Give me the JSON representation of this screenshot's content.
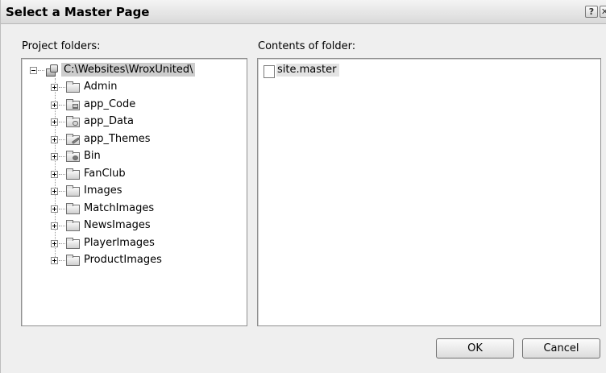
{
  "window": {
    "title": "Select a Master Page",
    "help_glyph": "?",
    "close_glyph": "✕"
  },
  "left": {
    "label": "Project folders:",
    "root": "C:\\Websites\\WroxUnited\\",
    "folders": [
      {
        "label": "Admin",
        "icon": "folder-icon"
      },
      {
        "label": "app_Code",
        "icon": "code-folder-icon"
      },
      {
        "label": "app_Data",
        "icon": "data-folder-icon"
      },
      {
        "label": "app_Themes",
        "icon": "themes-folder-icon"
      },
      {
        "label": "Bin",
        "icon": "bin-folder-icon"
      },
      {
        "label": "FanClub",
        "icon": "folder-icon"
      },
      {
        "label": "Images",
        "icon": "folder-icon"
      },
      {
        "label": "MatchImages",
        "icon": "folder-icon"
      },
      {
        "label": "NewsImages",
        "icon": "folder-icon"
      },
      {
        "label": "PlayerImages",
        "icon": "folder-icon"
      },
      {
        "label": "ProductImages",
        "icon": "folder-icon"
      }
    ]
  },
  "right": {
    "label": "Contents of folder:",
    "files": [
      {
        "label": "site.master",
        "icon": "master-page-file-icon"
      }
    ]
  },
  "buttons": {
    "ok": "OK",
    "cancel": "Cancel"
  }
}
